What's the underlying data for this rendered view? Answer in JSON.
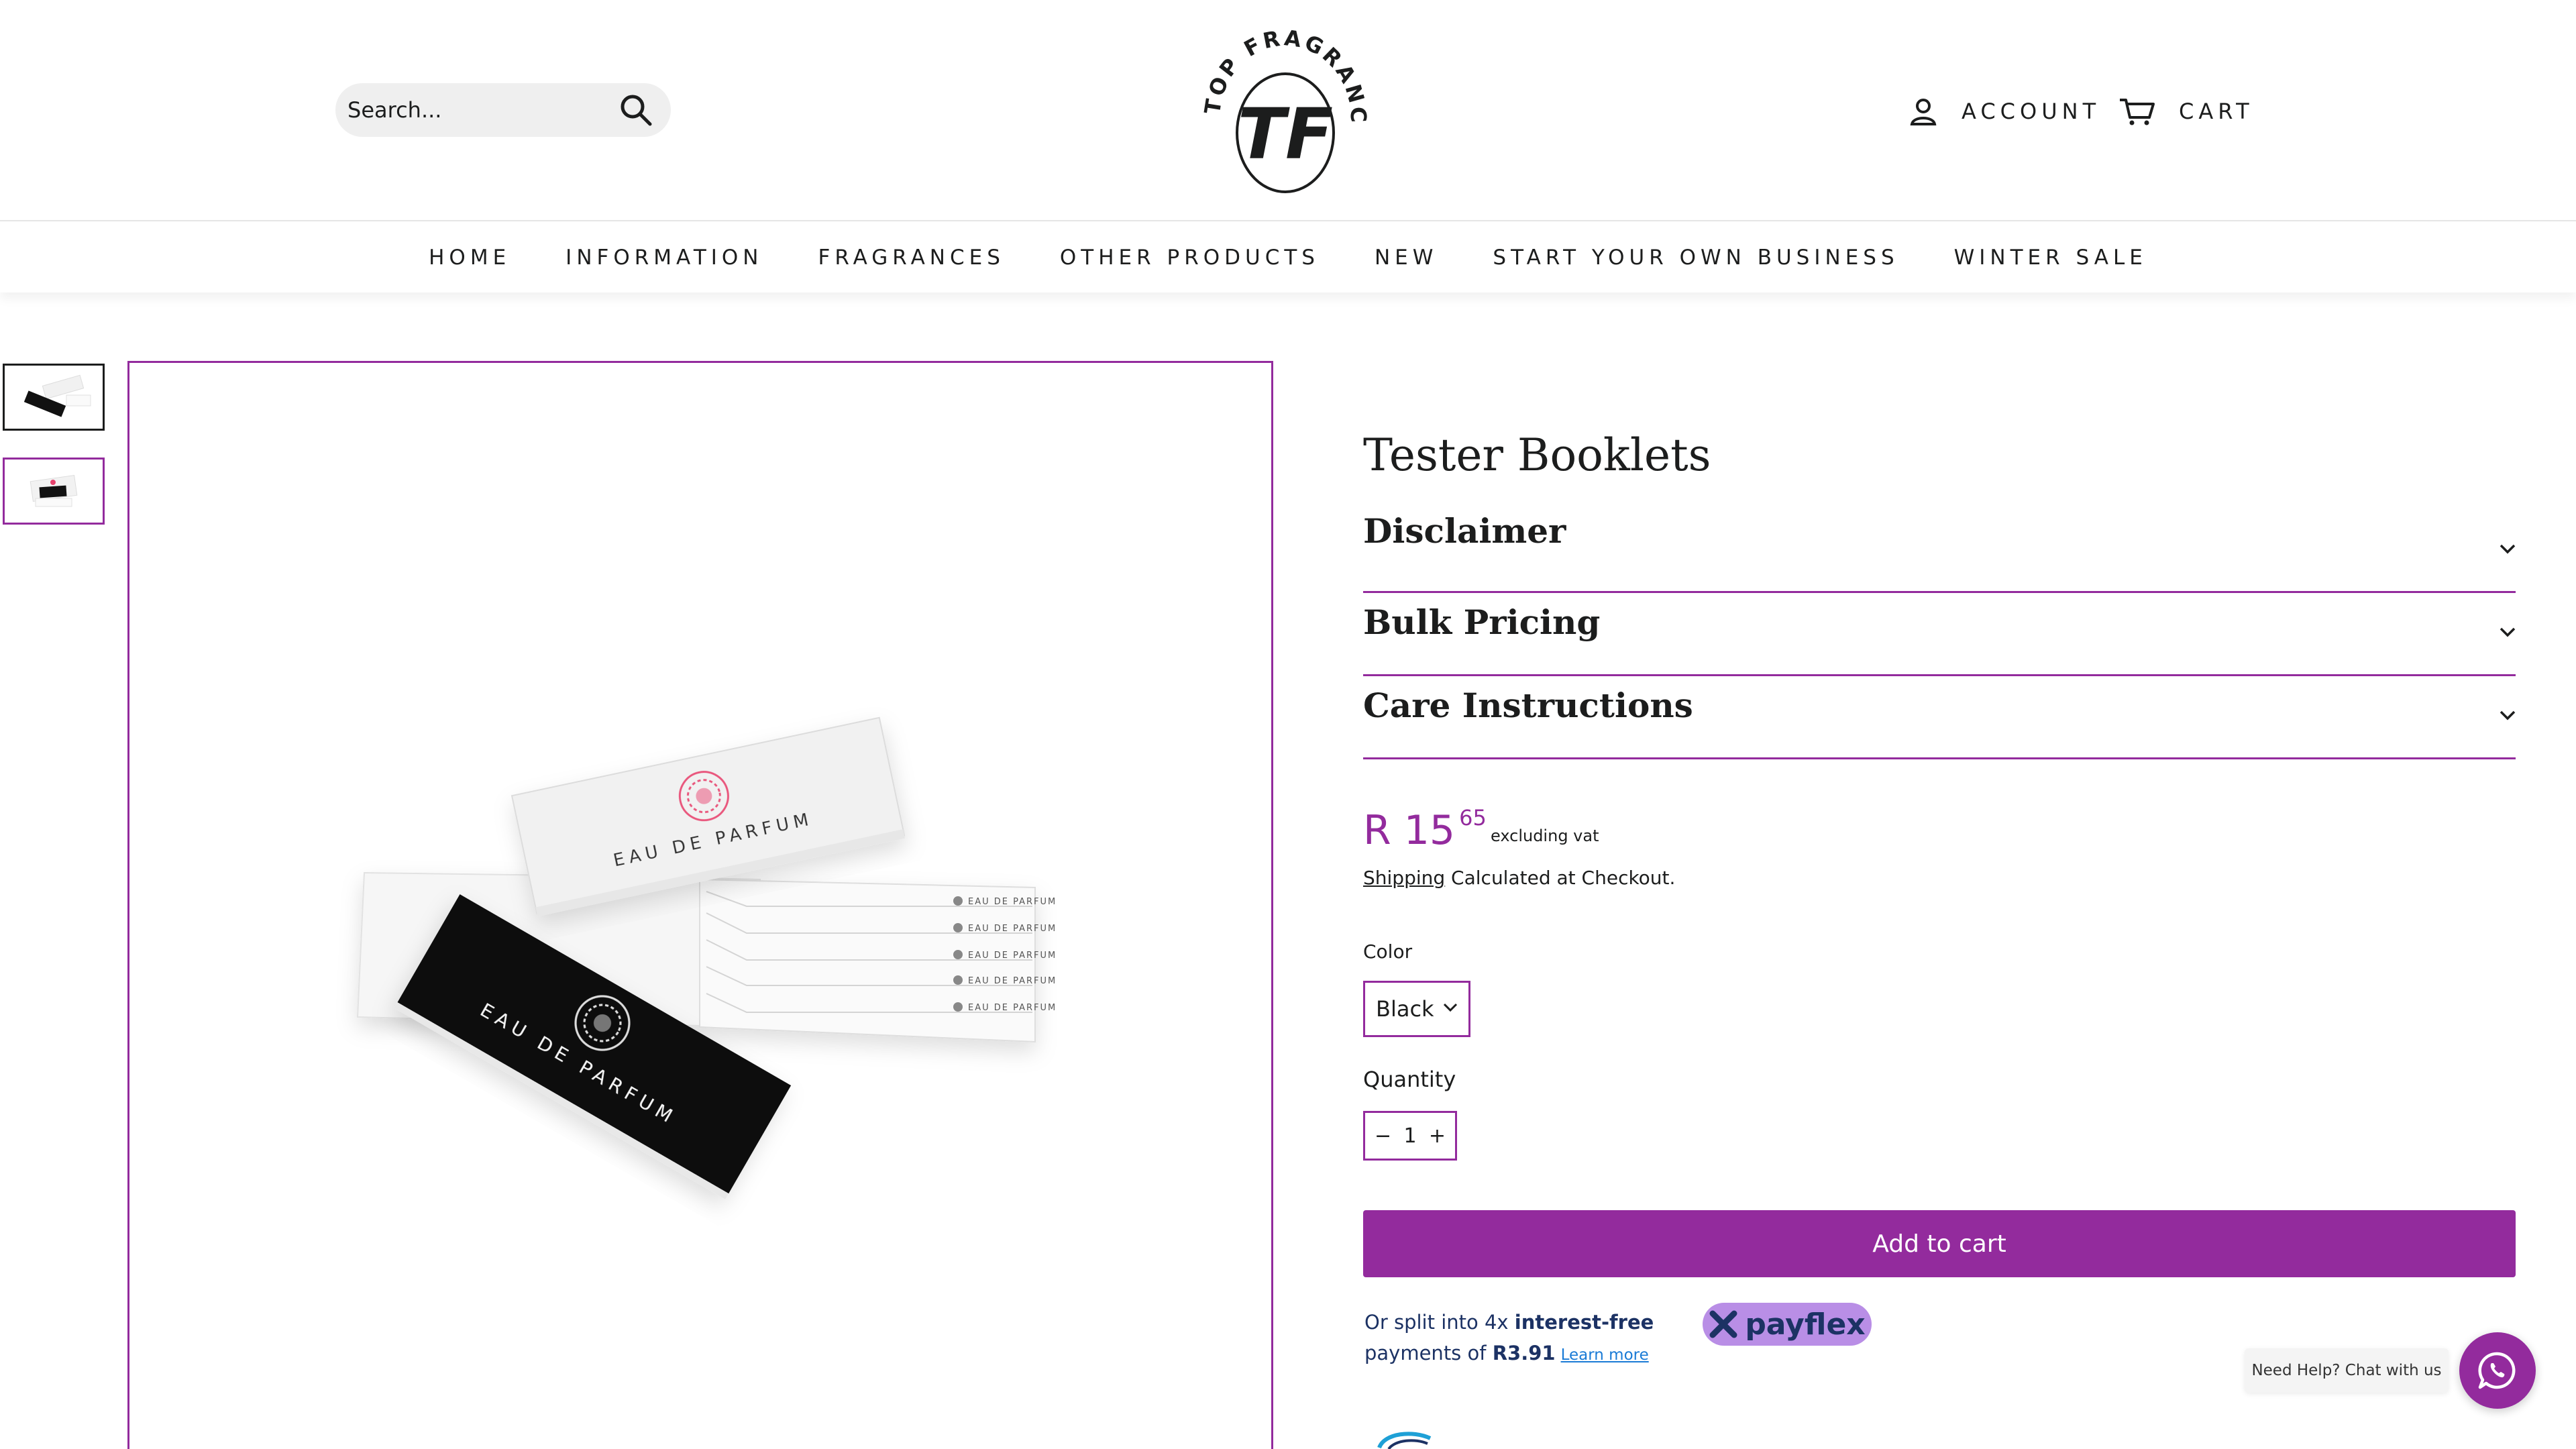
{
  "header": {
    "search": {
      "placeholder": "Search...",
      "icon": "search-icon"
    },
    "logo": {
      "text": "TOP FRAGRANCES",
      "monogram": "TF"
    },
    "account_label": "ACCOUNT",
    "cart_label": "CART"
  },
  "nav": {
    "items": [
      {
        "label": "HOME"
      },
      {
        "label": "INFORMATION"
      },
      {
        "label": "FRAGRANCES"
      },
      {
        "label": "OTHER PRODUCTS"
      },
      {
        "label": "NEW"
      },
      {
        "label": "START YOUR OWN BUSINESS"
      },
      {
        "label": "WINTER SALE"
      }
    ]
  },
  "gallery": {
    "image_text": "EAU DE PARFUM"
  },
  "product": {
    "title": "Tester Booklets",
    "accordions": [
      {
        "title": "Disclaimer"
      },
      {
        "title": "Bulk Pricing"
      },
      {
        "title": "Care Instructions"
      }
    ],
    "price": {
      "whole": "R 15",
      "cents": "65",
      "note": "excluding vat"
    },
    "shipping": {
      "link": "Shipping",
      "text": " Calculated at Checkout."
    },
    "color": {
      "label": "Color",
      "value": "Black"
    },
    "quantity": {
      "label": "Quantity",
      "value": "1",
      "minus": "−",
      "plus": "+"
    },
    "add_to_cart": "Add to cart",
    "payflex": {
      "line1_prefix": "Or split into 4x ",
      "line1_bold": "interest-free",
      "line2_prefix": "payments of ",
      "line2_amount": "R3.91",
      "learn_more": "Learn more",
      "brand": "payflex"
    }
  },
  "chat": {
    "label": "Need Help? Chat with us",
    "icon": "whatsapp-icon"
  },
  "colors": {
    "accent": "#932b9d",
    "text": "#1c1d1d",
    "payflex": "#b98ee6"
  }
}
